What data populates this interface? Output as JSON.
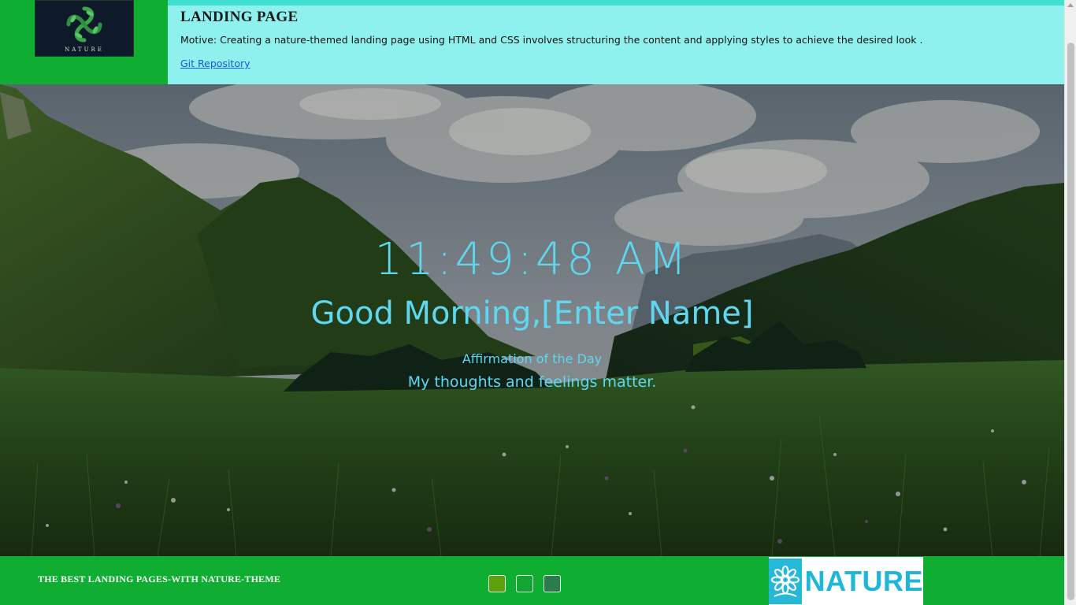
{
  "header": {
    "logo_text": "NATURE",
    "title": "LANDING PAGE",
    "motive": "Motive: Creating a nature-themed landing page using HTML and CSS involves structuring the content and applying styles to achieve the desired look .",
    "repo_link": "Git Repository"
  },
  "hero": {
    "time": "11:49:48 AM",
    "greeting": "Good Morning,",
    "name_placeholder": "[Enter Name]",
    "affirmation_label": "Affirmation of the Day",
    "affirmation_text": "My thoughts and feelings matter."
  },
  "footer": {
    "tagline": "THE BEST LANDING PAGES-WITH NATURE-THEME",
    "swatches": [
      {
        "name": "theme-swatch-olive",
        "color": "#5ca10c"
      },
      {
        "name": "theme-swatch-green",
        "color": "#12a531"
      },
      {
        "name": "theme-swatch-dark-green",
        "color": "#2a7c4a"
      }
    ],
    "brand_text": "NATURE",
    "brand_icon": "flower-icon"
  },
  "colors": {
    "header_green": "#0fae32",
    "header_cyan": "#8ef1ee",
    "accent_text": "#5dd8f2",
    "link": "#1a55d8"
  }
}
